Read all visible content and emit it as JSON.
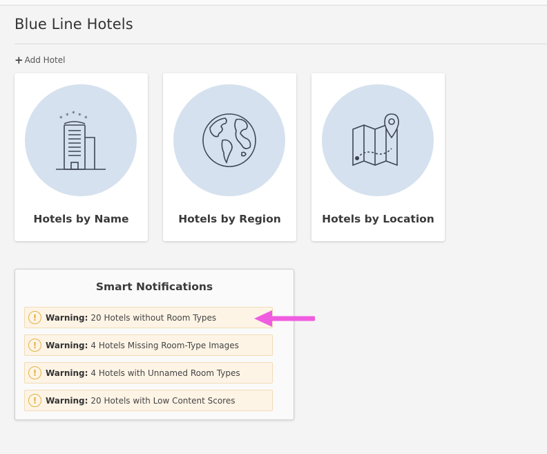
{
  "page": {
    "title": "Blue Line Hotels",
    "add_hotel_label": "Add Hotel"
  },
  "cards": [
    {
      "label": "Hotels by Name",
      "icon": "hotel-building-icon"
    },
    {
      "label": "Hotels by Region",
      "icon": "globe-icon"
    },
    {
      "label": "Hotels by Location",
      "icon": "map-pin-icon"
    }
  ],
  "notifications": {
    "title": "Smart Notifications",
    "items": [
      {
        "label": "Warning:",
        "text": "20 Hotels without Room Types"
      },
      {
        "label": "Warning:",
        "text": "4 Hotels Missing Room-Type Images"
      },
      {
        "label": "Warning:",
        "text": "4 Hotels with Unnamed Room Types"
      },
      {
        "label": "Warning:",
        "text": "20 Hotels with Low Content Scores"
      }
    ]
  },
  "colors": {
    "circle_bg": "#d5e1ee",
    "warning_bg": "#fdf4e6",
    "warning_icon": "#e2b13c",
    "annotation_arrow": "#f05ce0"
  }
}
